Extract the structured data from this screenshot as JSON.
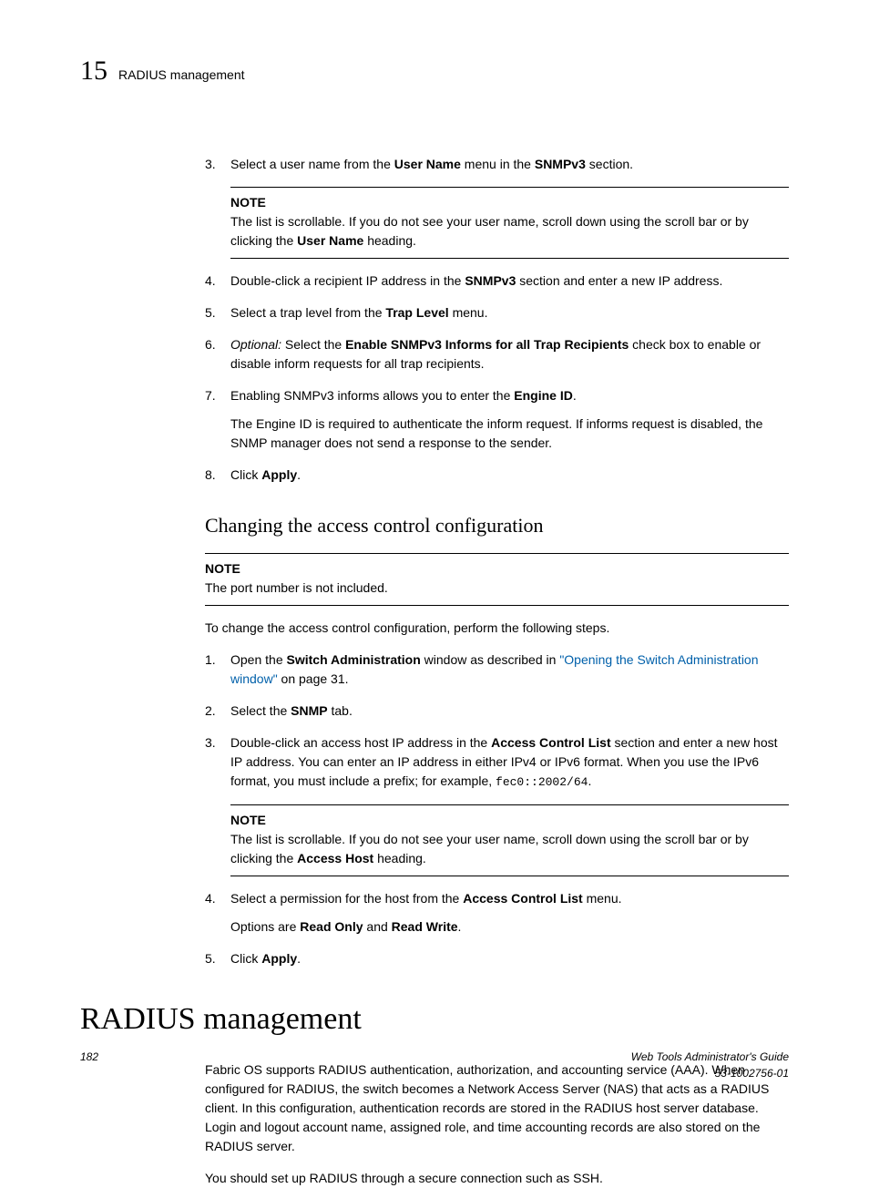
{
  "header": {
    "chapter_num": "15",
    "title": "RADIUS management"
  },
  "steps_a": [
    {
      "num": "3.",
      "parts": [
        {
          "t": "Select a user name from the "
        },
        {
          "t": "User Name",
          "b": true
        },
        {
          "t": " menu in the "
        },
        {
          "t": "SNMPv3",
          "b": true
        },
        {
          "t": " section."
        }
      ],
      "note": {
        "label": "NOTE",
        "parts": [
          {
            "t": "The list is scrollable. If you do not see your user name, scroll down using the scroll bar or by clicking the "
          },
          {
            "t": "User Name",
            "b": true
          },
          {
            "t": " heading."
          }
        ]
      }
    },
    {
      "num": "4.",
      "parts": [
        {
          "t": "Double-click a recipient IP address in the "
        },
        {
          "t": "SNMPv3",
          "b": true
        },
        {
          "t": " section and enter a new IP address."
        }
      ]
    },
    {
      "num": "5.",
      "parts": [
        {
          "t": "Select a trap level from the "
        },
        {
          "t": "Trap Level",
          "b": true
        },
        {
          "t": " menu."
        }
      ]
    },
    {
      "num": "6.",
      "parts": [
        {
          "t": "Optional:",
          "i": true
        },
        {
          "t": " Select the "
        },
        {
          "t": "Enable SNMPv3 Informs for all Trap Recipients",
          "b": true
        },
        {
          "t": " check box to enable or disable inform requests for all trap recipients."
        }
      ]
    },
    {
      "num": "7.",
      "parts": [
        {
          "t": "Enabling SNMPv3 informs allows you to enter the "
        },
        {
          "t": "Engine ID",
          "b": true
        },
        {
          "t": "."
        }
      ],
      "sub": [
        {
          "t": "The Engine ID is required to authenticate the inform request. If informs request is disabled, the SNMP manager does not send a response to the sender."
        }
      ]
    },
    {
      "num": "8.",
      "parts": [
        {
          "t": "Click "
        },
        {
          "t": "Apply",
          "b": true
        },
        {
          "t": "."
        }
      ]
    }
  ],
  "section_b": {
    "heading": "Changing the access control configuration",
    "note": {
      "label": "NOTE",
      "text": "The port number is not included."
    },
    "intro": "To change the access control configuration, perform the following steps.",
    "steps": [
      {
        "num": "1.",
        "parts": [
          {
            "t": "Open the "
          },
          {
            "t": "Switch Administration",
            "b": true
          },
          {
            "t": " window as described in "
          },
          {
            "t": "\"Opening the Switch Administration window\"",
            "link": true
          },
          {
            "t": " on page 31."
          }
        ]
      },
      {
        "num": "2.",
        "parts": [
          {
            "t": "Select the "
          },
          {
            "t": "SNMP",
            "b": true
          },
          {
            "t": " tab."
          }
        ]
      },
      {
        "num": "3.",
        "parts": [
          {
            "t": "Double-click an access host IP address in the "
          },
          {
            "t": "Access Control List",
            "b": true
          },
          {
            "t": " section and enter a new host IP address. You can enter an IP address in either IPv4 or IPv6 format. When you use the IPv6 format, you must include a prefix; for example, "
          },
          {
            "t": "fec0::2002/64",
            "mono": true
          },
          {
            "t": "."
          }
        ],
        "note": {
          "label": "NOTE",
          "parts": [
            {
              "t": "The list is scrollable. If you do not see your user name, scroll down using the scroll bar or by clicking the "
            },
            {
              "t": "Access Host",
              "b": true
            },
            {
              "t": " heading."
            }
          ]
        }
      },
      {
        "num": "4.",
        "parts": [
          {
            "t": "Select a permission for the host from the "
          },
          {
            "t": "Access Control List",
            "b": true
          },
          {
            "t": " menu."
          }
        ],
        "sub": [
          {
            "t": "Options are "
          },
          {
            "t": "Read Only",
            "b": true
          },
          {
            "t": " and "
          },
          {
            "t": "Read Write",
            "b": true
          },
          {
            "t": "."
          }
        ]
      },
      {
        "num": "5.",
        "parts": [
          {
            "t": "Click "
          },
          {
            "t": "Apply",
            "b": true
          },
          {
            "t": "."
          }
        ]
      }
    ]
  },
  "section_c": {
    "heading": "RADIUS management",
    "para1": "Fabric OS supports RADIUS authentication, authorization, and accounting service (AAA). When configured for RADIUS, the switch becomes a Network Access Server (NAS) that acts as a RADIUS client. In this configuration, authentication records are stored in the RADIUS host server database. Login and logout account name, assigned role, and time accounting records are also stored on the RADIUS server.",
    "para2": "You should set up RADIUS through a secure connection such as SSH."
  },
  "footer": {
    "page_num": "182",
    "guide": "Web Tools Administrator's Guide",
    "doc_id": "53-1002756-01"
  }
}
